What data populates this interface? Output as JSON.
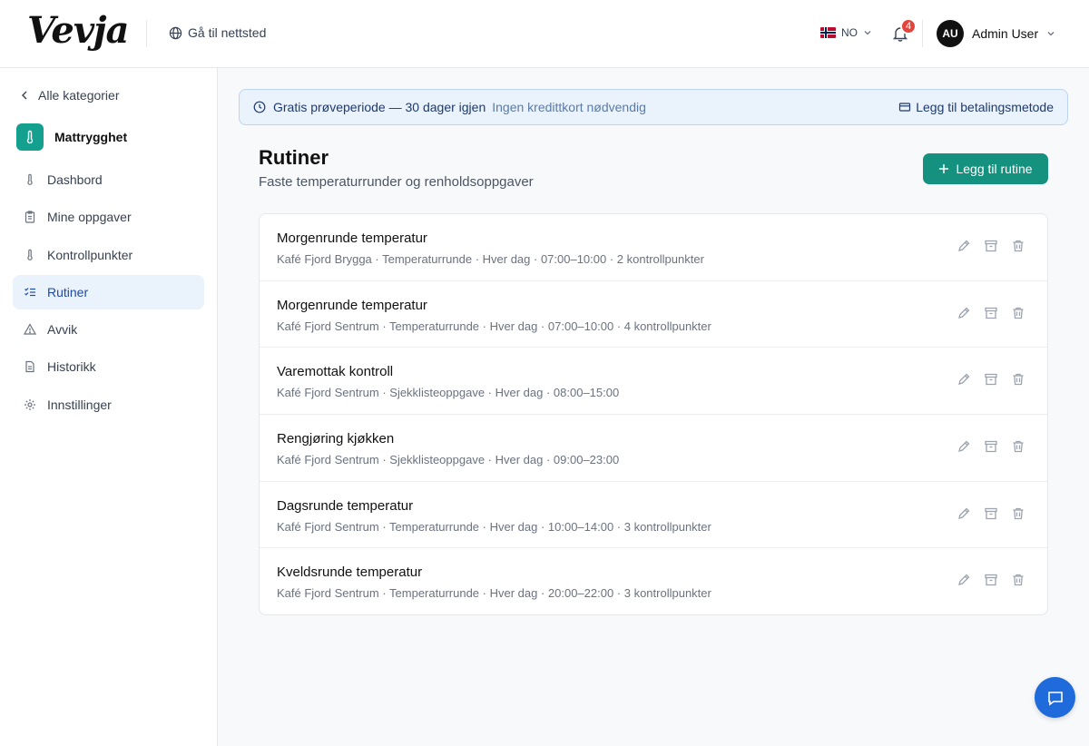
{
  "header": {
    "logo": "Vevja",
    "site_link": "Gå til nettsted",
    "language": "NO",
    "notification_count": "4",
    "user_initials": "AU",
    "user_name": "Admin User"
  },
  "sidebar": {
    "back_label": "Alle kategorier",
    "category": "Mattrygghet",
    "items": [
      {
        "label": "Dashbord",
        "icon": "thermometer-icon"
      },
      {
        "label": "Mine oppgaver",
        "icon": "clipboard-icon"
      },
      {
        "label": "Kontrollpunkter",
        "icon": "thermometer-icon"
      },
      {
        "label": "Rutiner",
        "icon": "checklist-icon",
        "active": true
      },
      {
        "label": "Avvik",
        "icon": "warning-icon"
      },
      {
        "label": "Historikk",
        "icon": "document-icon"
      },
      {
        "label": "Innstillinger",
        "icon": "gear-icon"
      }
    ]
  },
  "banner": {
    "title": "Gratis prøveperiode — 30 dager igjen",
    "subtitle": "Ingen kredittkort nødvendig",
    "action": "Legg til betalingsmetode"
  },
  "main": {
    "title": "Rutiner",
    "subtitle": "Faste temperaturrunder og renholdsoppgaver",
    "add_button": "Legg til rutine"
  },
  "routines": [
    {
      "title": "Morgenrunde temperatur",
      "meta": "Kafé Fjord Brygga · Temperaturrunde · Hver dag · 07:00–10:00 · 2 kontrollpunkter"
    },
    {
      "title": "Morgenrunde temperatur",
      "meta": "Kafé Fjord Sentrum · Temperaturrunde · Hver dag · 07:00–10:00 · 4 kontrollpunkter"
    },
    {
      "title": "Varemottak kontroll",
      "meta": "Kafé Fjord Sentrum · Sjekklisteoppgave · Hver dag · 08:00–15:00"
    },
    {
      "title": "Rengjøring kjøkken",
      "meta": "Kafé Fjord Sentrum · Sjekklisteoppgave · Hver dag · 09:00–23:00"
    },
    {
      "title": "Dagsrunde temperatur",
      "meta": "Kafé Fjord Sentrum · Temperaturrunde · Hver dag · 10:00–14:00 · 3 kontrollpunkter"
    },
    {
      "title": "Kveldsrunde temperatur",
      "meta": "Kafé Fjord Sentrum · Temperaturrunde · Hver dag · 20:00–22:00 · 3 kontrollpunkter"
    }
  ],
  "colors": {
    "accent": "#14927f",
    "nav_active_bg": "#eaf2fb",
    "nav_active_text": "#1e4aa8",
    "badge": "#e3443b",
    "chat_button": "#1f6bdb"
  }
}
